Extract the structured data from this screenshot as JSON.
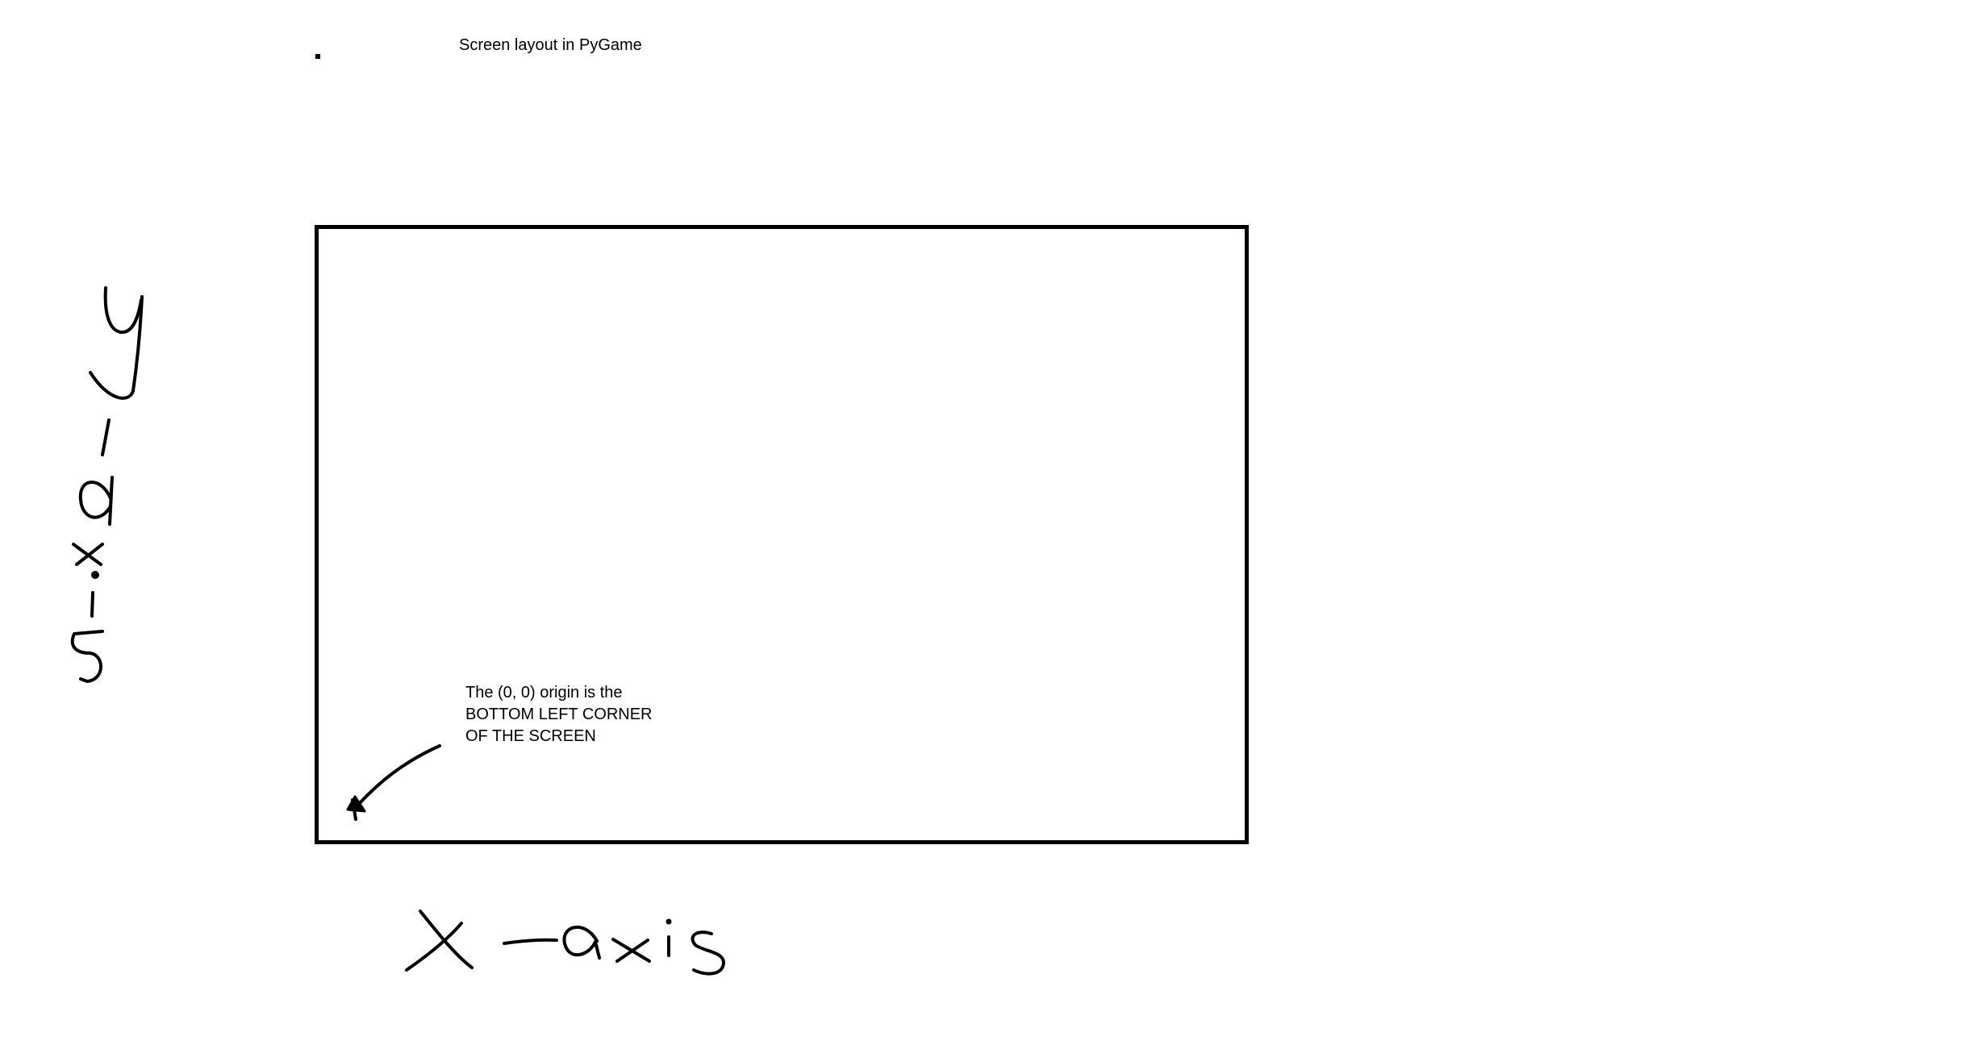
{
  "diagram": {
    "title": "Screen layout in PyGame",
    "origin_note": {
      "lines": [
        "The (0, 0) origin is the",
        "BOTTOM LEFT CORNER",
        "OF THE SCREEN"
      ]
    },
    "handwritten_labels": {
      "y_axis": "y-axis",
      "x_axis": "x-axis"
    },
    "colors": {
      "ink": "#000000",
      "background": "#ffffff"
    }
  }
}
